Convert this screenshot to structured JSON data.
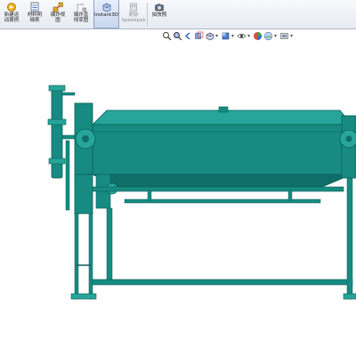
{
  "toolbar": {
    "buttons": [
      {
        "label": "新建运\n动算例",
        "icon": "new-motion-study-icon"
      },
      {
        "label": "材料明\n细表",
        "icon": "bill-of-materials-icon"
      },
      {
        "label": "爆炸视\n图",
        "icon": "exploded-view-icon"
      },
      {
        "label": "爆炸直\n线草图",
        "icon": "explode-line-sketch-icon"
      },
      {
        "label": "Instant3D",
        "icon": "instant3d-icon",
        "active": true
      },
      {
        "label": "更新\nSpeedpak",
        "icon": "update-speedpak-icon",
        "disabled": true
      },
      {
        "label": "拍快照",
        "icon": "take-snapshot-icon"
      }
    ]
  },
  "heads_up_toolbar": {
    "icons": [
      "zoom-to-fit-icon",
      "zoom-to-area-icon",
      "previous-view-icon",
      "section-view-icon",
      "view-orientation-icon",
      "display-style-icon",
      "hide-show-items-icon",
      "edit-appearance-icon",
      "apply-scene-icon",
      "view-settings-icon"
    ]
  },
  "model": {
    "color": "#178b82",
    "dark_color": "#0f6e68",
    "light_color": "#27a59b"
  }
}
